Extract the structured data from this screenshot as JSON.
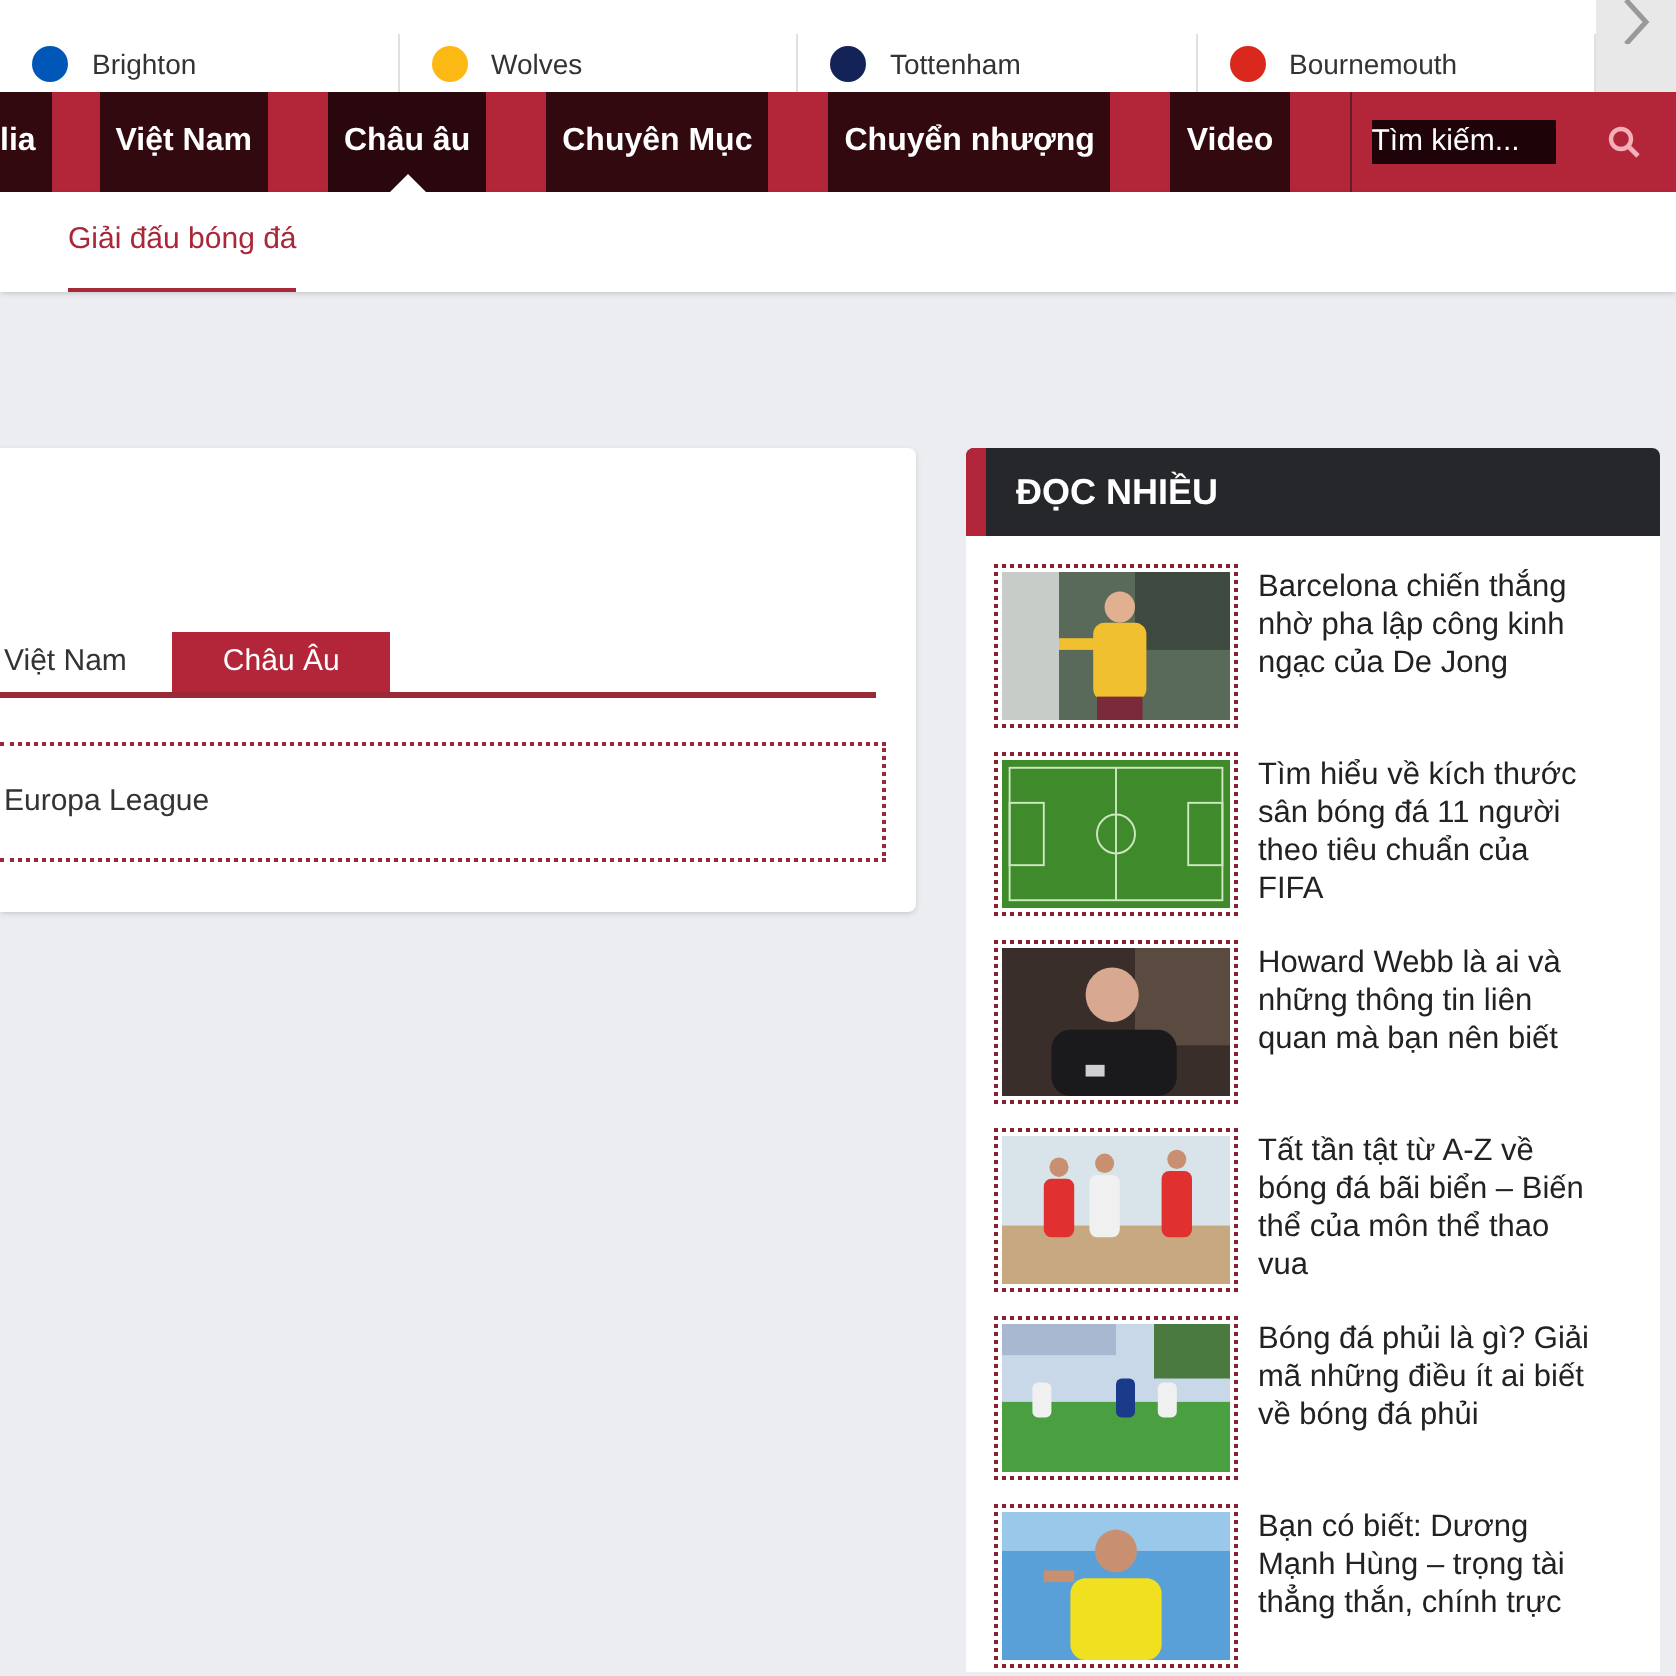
{
  "teams": [
    {
      "name": "Brighton"
    },
    {
      "name": "Wolves"
    },
    {
      "name": "Tottenham"
    },
    {
      "name": "Bournemouth"
    }
  ],
  "nav": {
    "items": [
      {
        "label": "lia",
        "selected": false
      },
      {
        "label": "Việt Nam",
        "selected": false
      },
      {
        "label": "Châu âu",
        "selected": true
      },
      {
        "label": "Chuyên Mục",
        "selected": false
      },
      {
        "label": "Chuyển nhượng",
        "selected": false
      },
      {
        "label": "Video",
        "selected": false
      }
    ],
    "search": {
      "placeholder": "Tìm kiếm..."
    }
  },
  "subnav": {
    "items": [
      {
        "label": "Giải đấu bóng đá",
        "selected": true
      }
    ]
  },
  "league_card": {
    "tabs": [
      {
        "label": "Việt Nam",
        "selected": false
      },
      {
        "label": "Châu Âu",
        "selected": true
      }
    ],
    "items": [
      "Europa League"
    ]
  },
  "most_read": {
    "title": "ĐỌC NHIỀU",
    "articles": [
      {
        "title": "Barcelona chiến thắng nhờ pha lập công kinh ngạc của De Jong"
      },
      {
        "title": "Tìm hiểu về kích thước sân bóng đá 11 người theo tiêu chuẩn của FIFA"
      },
      {
        "title": "Howard Webb là ai và những thông tin liên quan mà bạn nên biết"
      },
      {
        "title": "Tất tần tật từ A-Z về bóng đá bãi biển – Biến thể của môn thể thao vua"
      },
      {
        "title": "Bóng đá phủi là gì? Giải mã những điều ít ai biết về bóng đá phủi"
      },
      {
        "title": "Bạn có biết: Dương Mạnh Hùng – trọng tài thẳng thắn, chính trực"
      }
    ]
  }
}
